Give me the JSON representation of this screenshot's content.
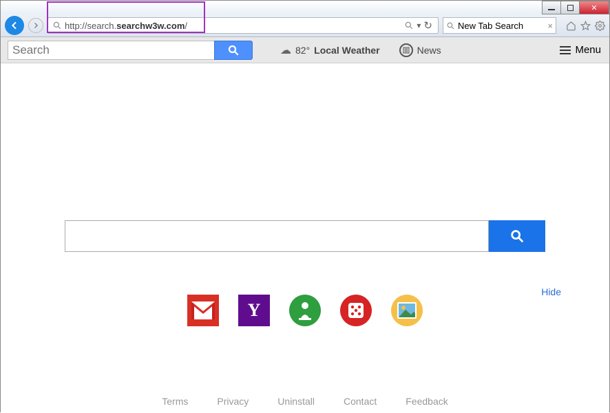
{
  "window": {
    "min": "_",
    "max": "□",
    "close": "✕"
  },
  "browser": {
    "url_prefix": "http://search.",
    "url_domain": "searchw3w.com",
    "url_suffix": "/",
    "tab_title": "New Tab Search",
    "refresh": "↻",
    "dropdown": "▾"
  },
  "toolbar": {
    "search_placeholder": "Search",
    "weather_temp": "82°",
    "weather_label": "Local Weather",
    "news_label": "News",
    "menu_label": "Menu"
  },
  "main": {
    "search_value": "",
    "hide_label": "Hide",
    "yahoo_letter": "Y"
  },
  "footer": {
    "terms": "Terms",
    "privacy": "Privacy",
    "uninstall": "Uninstall",
    "contact": "Contact",
    "feedback": "Feedback"
  }
}
